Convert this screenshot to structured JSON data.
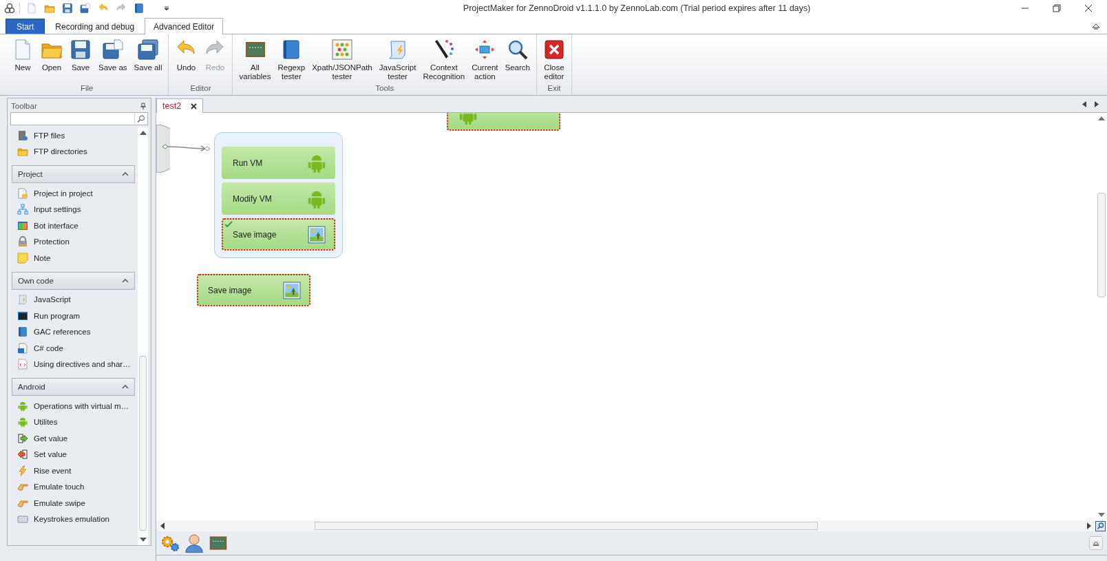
{
  "window": {
    "title": "ProjectMaker for ZennoDroid v1.1.1.0 by ZennoLab.com (Trial period expires after 11 days)"
  },
  "ribbon_tabs": [
    {
      "label": "Start",
      "kind": "app"
    },
    {
      "label": "Recording and debug",
      "selected": false,
      "kind": "tab"
    },
    {
      "label": "Advanced Editor",
      "selected": true,
      "kind": "tab"
    }
  ],
  "ribbon": {
    "groups": [
      {
        "label": "File",
        "buttons": [
          {
            "label": "New",
            "disabled": false
          },
          {
            "label": "Open",
            "disabled": false
          },
          {
            "label": "Save",
            "disabled": false
          },
          {
            "label": "Save as",
            "disabled": false
          },
          {
            "label": "Save all",
            "disabled": false
          }
        ]
      },
      {
        "label": "Editor",
        "buttons": [
          {
            "label": "Undo",
            "disabled": false
          },
          {
            "label": "Redo",
            "disabled": true
          }
        ]
      },
      {
        "label": "Tools",
        "buttons": [
          {
            "label": "All\nvariables",
            "disabled": false
          },
          {
            "label": "Regexp\ntester",
            "disabled": false
          },
          {
            "label": "Xpath/JSONPath\ntester",
            "disabled": false
          },
          {
            "label": "JavaScript\ntester",
            "disabled": false
          },
          {
            "label": "Context\nRecognition",
            "disabled": false
          },
          {
            "label": "Current\naction",
            "disabled": false
          },
          {
            "label": "Search",
            "disabled": false
          }
        ]
      },
      {
        "label": "Exit",
        "buttons": [
          {
            "label": "Close\neditor",
            "disabled": false
          }
        ]
      }
    ]
  },
  "sidebar": {
    "title": "Toolbar",
    "loose_items": [
      "FTP files",
      "FTP directories"
    ],
    "groups": [
      {
        "label": "Project",
        "expanded": true,
        "items": [
          "Project in project",
          "Input settings",
          "Bot interface",
          "Protection",
          "Note"
        ]
      },
      {
        "label": "Own code",
        "expanded": true,
        "items": [
          "JavaScript",
          "Run program",
          "GAC references",
          "C# code",
          "Using directives and shar…"
        ]
      },
      {
        "label": "Android",
        "expanded": true,
        "items": [
          "Operations with virtual m…",
          "Utilites",
          "Get value",
          "Set value",
          "Rise event",
          "Emulate touch",
          "Emulate swipe",
          "Keystrokes emulation"
        ]
      }
    ]
  },
  "document_tabs": [
    {
      "label": "test2",
      "selected": true
    }
  ],
  "canvas": {
    "groups": [
      {
        "nodes": [
          {
            "label": "Run VM",
            "kind": "android",
            "selected": false,
            "checked": false
          },
          {
            "label": "Modify VM",
            "kind": "android",
            "selected": false,
            "checked": false
          },
          {
            "label": "Save image",
            "kind": "image",
            "selected": true,
            "checked": true
          }
        ]
      }
    ],
    "nodes": [
      {
        "label": "Save image",
        "kind": "image",
        "selected": true,
        "checked": false
      },
      {
        "kind": "android",
        "selected": true,
        "checked": false
      }
    ]
  }
}
